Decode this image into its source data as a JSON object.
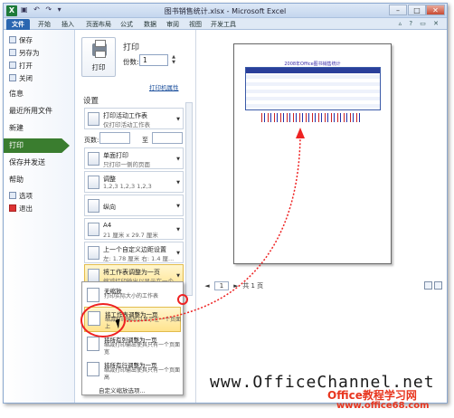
{
  "window": {
    "title": "图书销售统计.xlsx - Microsoft Excel",
    "min": "–",
    "max": "□",
    "close": "✕"
  },
  "quick_access": "▣ ↶ ↷ ▾",
  "tabs": {
    "file": "文件",
    "items": [
      "开始",
      "插入",
      "页面布局",
      "公式",
      "数据",
      "审阅",
      "视图",
      "开发工具"
    ]
  },
  "ribbon_right": "▵ ? ▭ ✕",
  "backstage": {
    "small_cmds": [
      "保存",
      "另存为",
      "打开",
      "关闭"
    ],
    "big_cmds": [
      "信息",
      "最近所用文件",
      "新建",
      "打印",
      "保存并发送",
      "帮助"
    ],
    "bottom_cmds": [
      "选项",
      "退出"
    ]
  },
  "print": {
    "button": "打印",
    "heading": "打印",
    "copies_label": "份数:",
    "copies_value": "1",
    "printer_properties": "打印机属性",
    "settings_heading": "设置",
    "pages_label": "页数:",
    "pages_to": "至",
    "options": [
      {
        "title": "打印活动工作表",
        "sub": "仅打印活动工作表"
      },
      {
        "title": "单面打印",
        "sub": "只打印一侧的页面"
      },
      {
        "title": "调整",
        "sub": "1,2,3    1,2,3    1,2,3"
      },
      {
        "title": "纵向",
        "sub": ""
      },
      {
        "title": "A4",
        "sub": "21 厘米 x 29.7 厘米"
      },
      {
        "title": "上一个自定义边距设置",
        "sub": "左: 1.78 厘米    右: 1.4 厘..."
      },
      {
        "title": "将工作表调整为一页",
        "sub": "缩减打印输出以显示在一个..."
      }
    ]
  },
  "scaling_menu": {
    "items": [
      {
        "title": "无缩放",
        "sub": "打印实际大小的工作表"
      },
      {
        "title": "将工作表调整为一页",
        "sub": "缩减打印输出以显示在一个页面上"
      },
      {
        "title": "将所有列调整为一页",
        "sub": "缩减打印输出使其只有一个页面宽"
      },
      {
        "title": "将所有行调整为一页",
        "sub": "缩减打印输出使其只有一个页面高"
      }
    ],
    "custom": "自定义缩放选项..."
  },
  "preview": {
    "sheet_title": "2008年Office图书销售统计",
    "page_current": "1",
    "page_total": "共 1 页",
    "prev": "◄",
    "next": "►"
  },
  "watermark": {
    "main": "www.OfficeChannel.net",
    "cn": "Office教程学习网",
    "url": "www.office68.com"
  }
}
